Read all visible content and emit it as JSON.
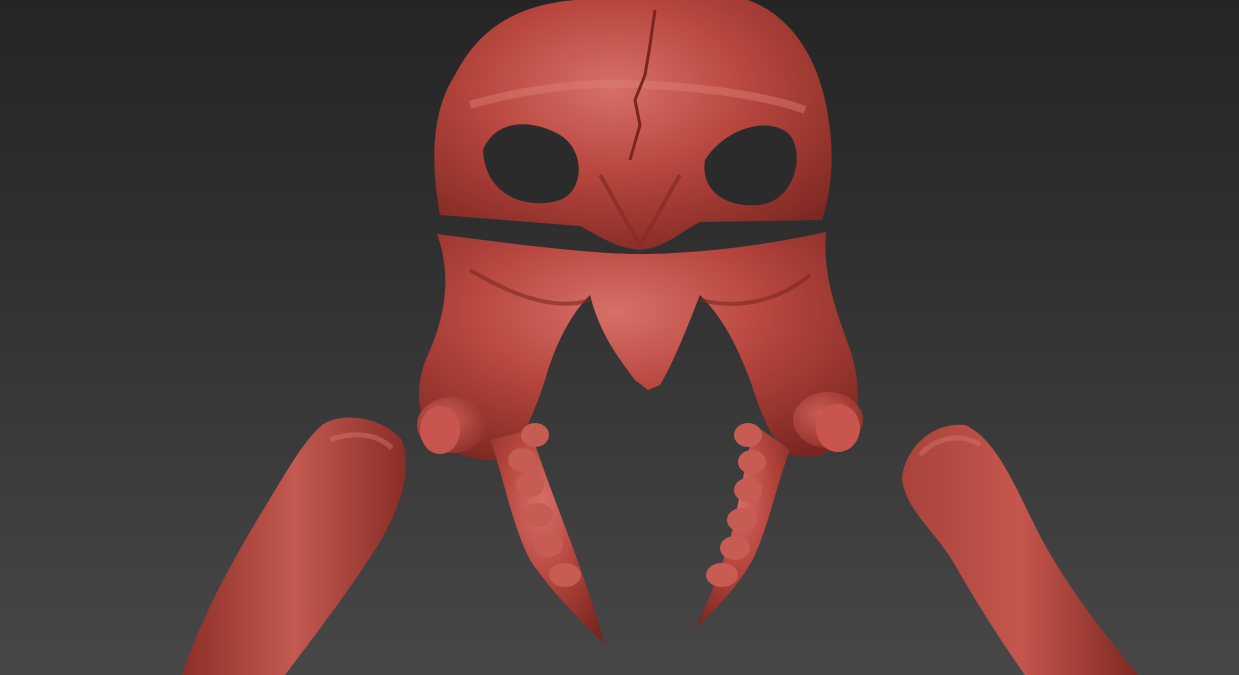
{
  "viewport": {
    "background_top": "#252525",
    "background_bottom": "#474747",
    "material_color": "#b8473f"
  },
  "model": {
    "parts": [
      "skull-top-icon",
      "jaw-icon",
      "left-tentacle-icon",
      "right-tentacle-icon",
      "left-arm-icon",
      "right-arm-icon"
    ]
  }
}
